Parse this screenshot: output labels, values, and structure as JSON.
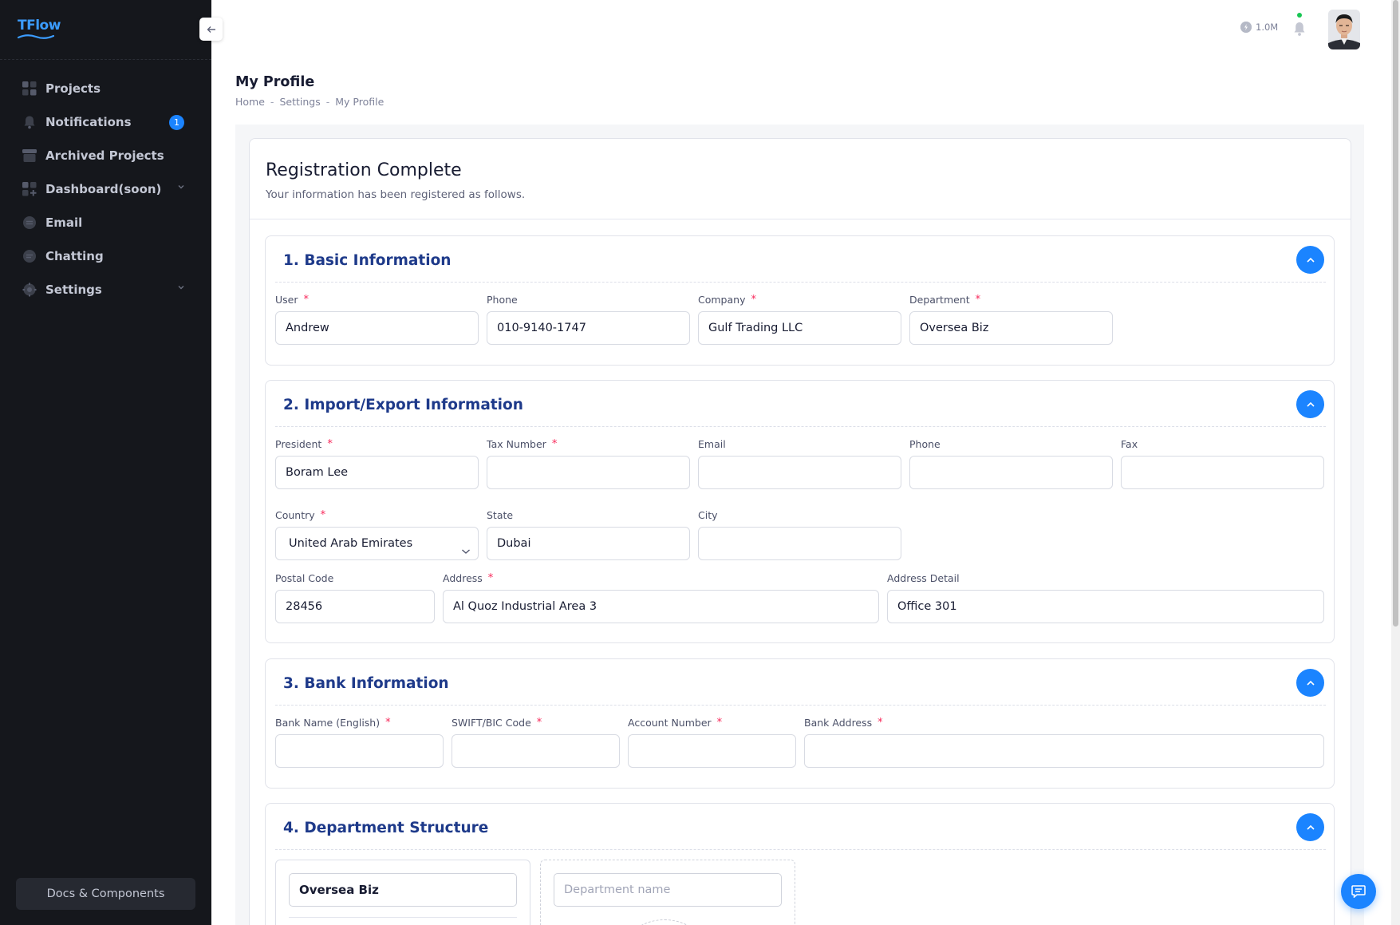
{
  "app": {
    "logo_text": "TFlow"
  },
  "sidebar": {
    "items": [
      {
        "label": "Projects",
        "icon": "grid-icon"
      },
      {
        "label": "Notifications",
        "icon": "bell-icon",
        "badge": "1"
      },
      {
        "label": "Archived Projects",
        "icon": "archive-icon"
      },
      {
        "label": "Dashboard(soon)",
        "icon": "dashboard-icon",
        "has_submenu": true
      },
      {
        "label": "Email",
        "icon": "email-icon"
      },
      {
        "label": "Chatting",
        "icon": "chat-icon"
      },
      {
        "label": "Settings",
        "icon": "gear-icon",
        "has_submenu": true
      }
    ],
    "docs_button": "Docs & Components"
  },
  "header": {
    "credits": "1.0M",
    "notification_status_color": "#17c653"
  },
  "page": {
    "title": "My Profile",
    "breadcrumb": [
      "Home",
      "Settings",
      "My Profile"
    ]
  },
  "card": {
    "title": "Registration Complete",
    "subtitle": "Your information has been registered as follows."
  },
  "sections": {
    "basic": {
      "title": "1. Basic Information",
      "fields": {
        "user": {
          "label": "User",
          "value": "Andrew",
          "required": true
        },
        "phone": {
          "label": "Phone",
          "value": "010-9140-1747",
          "required": false
        },
        "company": {
          "label": "Company",
          "value": "Gulf Trading LLC",
          "required": true
        },
        "department": {
          "label": "Department",
          "value": "Oversea Biz",
          "required": true
        }
      }
    },
    "import_export": {
      "title": "2. Import/Export Information",
      "fields": {
        "president": {
          "label": "President",
          "value": "Boram Lee",
          "required": true
        },
        "tax_number": {
          "label": "Tax Number",
          "value": "",
          "required": true
        },
        "email": {
          "label": "Email",
          "value": "",
          "required": false
        },
        "phone": {
          "label": "Phone",
          "value": "",
          "required": false
        },
        "fax": {
          "label": "Fax",
          "value": "",
          "required": false
        },
        "country": {
          "label": "Country",
          "value": "United Arab Emirates",
          "required": true
        },
        "state": {
          "label": "State",
          "value": "Dubai",
          "required": false
        },
        "city": {
          "label": "City",
          "value": "",
          "required": false
        },
        "postal_code": {
          "label": "Postal Code",
          "value": "28456",
          "required": false
        },
        "address": {
          "label": "Address",
          "value": "Al Quoz Industrial Area 3",
          "required": true
        },
        "address_detail": {
          "label": "Address Detail",
          "value": "Office 301",
          "required": false
        }
      }
    },
    "bank": {
      "title": "3. Bank Information",
      "fields": {
        "bank_name": {
          "label": "Bank Name (English)",
          "value": "",
          "required": true
        },
        "swift": {
          "label": "SWIFT/BIC Code",
          "value": "",
          "required": true
        },
        "account_number": {
          "label": "Account Number",
          "value": "",
          "required": true
        },
        "bank_address": {
          "label": "Bank Address",
          "value": "",
          "required": true
        }
      }
    },
    "department": {
      "title": "4. Department Structure",
      "existing": "Oversea Biz",
      "new_placeholder": "Department name"
    }
  },
  "colors": {
    "sidebar_bg": "#15171c",
    "accent": "#1b84ff",
    "section_title": "#1e3a8a",
    "required": "#f8285a"
  }
}
